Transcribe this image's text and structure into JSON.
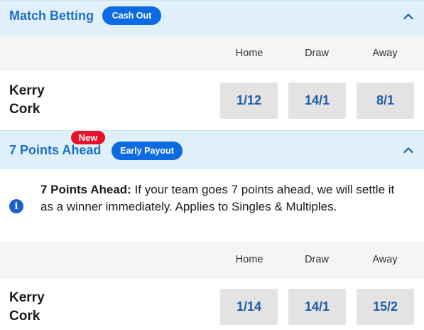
{
  "markets": [
    {
      "title": "Match Betting",
      "badge": "Cash Out",
      "columns": [
        "Home",
        "Draw",
        "Away"
      ],
      "teams": [
        "Kerry",
        "Cork"
      ],
      "odds": [
        "1/12",
        "14/1",
        "8/1"
      ]
    },
    {
      "title": "7 Points Ahead",
      "new_badge": "New",
      "badge": "Early Payout",
      "info": {
        "heading": "7 Points Ahead:",
        "text": " If your team goes 7 points ahead, we will settle it as a winner immediately. Applies to Singles & Multiples."
      },
      "columns": [
        "Home",
        "Draw",
        "Away"
      ],
      "teams": [
        "Kerry",
        "Cork"
      ],
      "odds": [
        "1/14",
        "14/1",
        "15/2"
      ]
    }
  ],
  "icons": {
    "collapse": "chevron-up-icon",
    "info": "info-icon"
  },
  "colors": {
    "header_bg": "#dff0fb",
    "title": "#1f6fc4",
    "pill": "#0c6be0",
    "new": "#e8102a",
    "odds_text": "#1f5ca8",
    "odds_bg": "#e3e3e3"
  }
}
